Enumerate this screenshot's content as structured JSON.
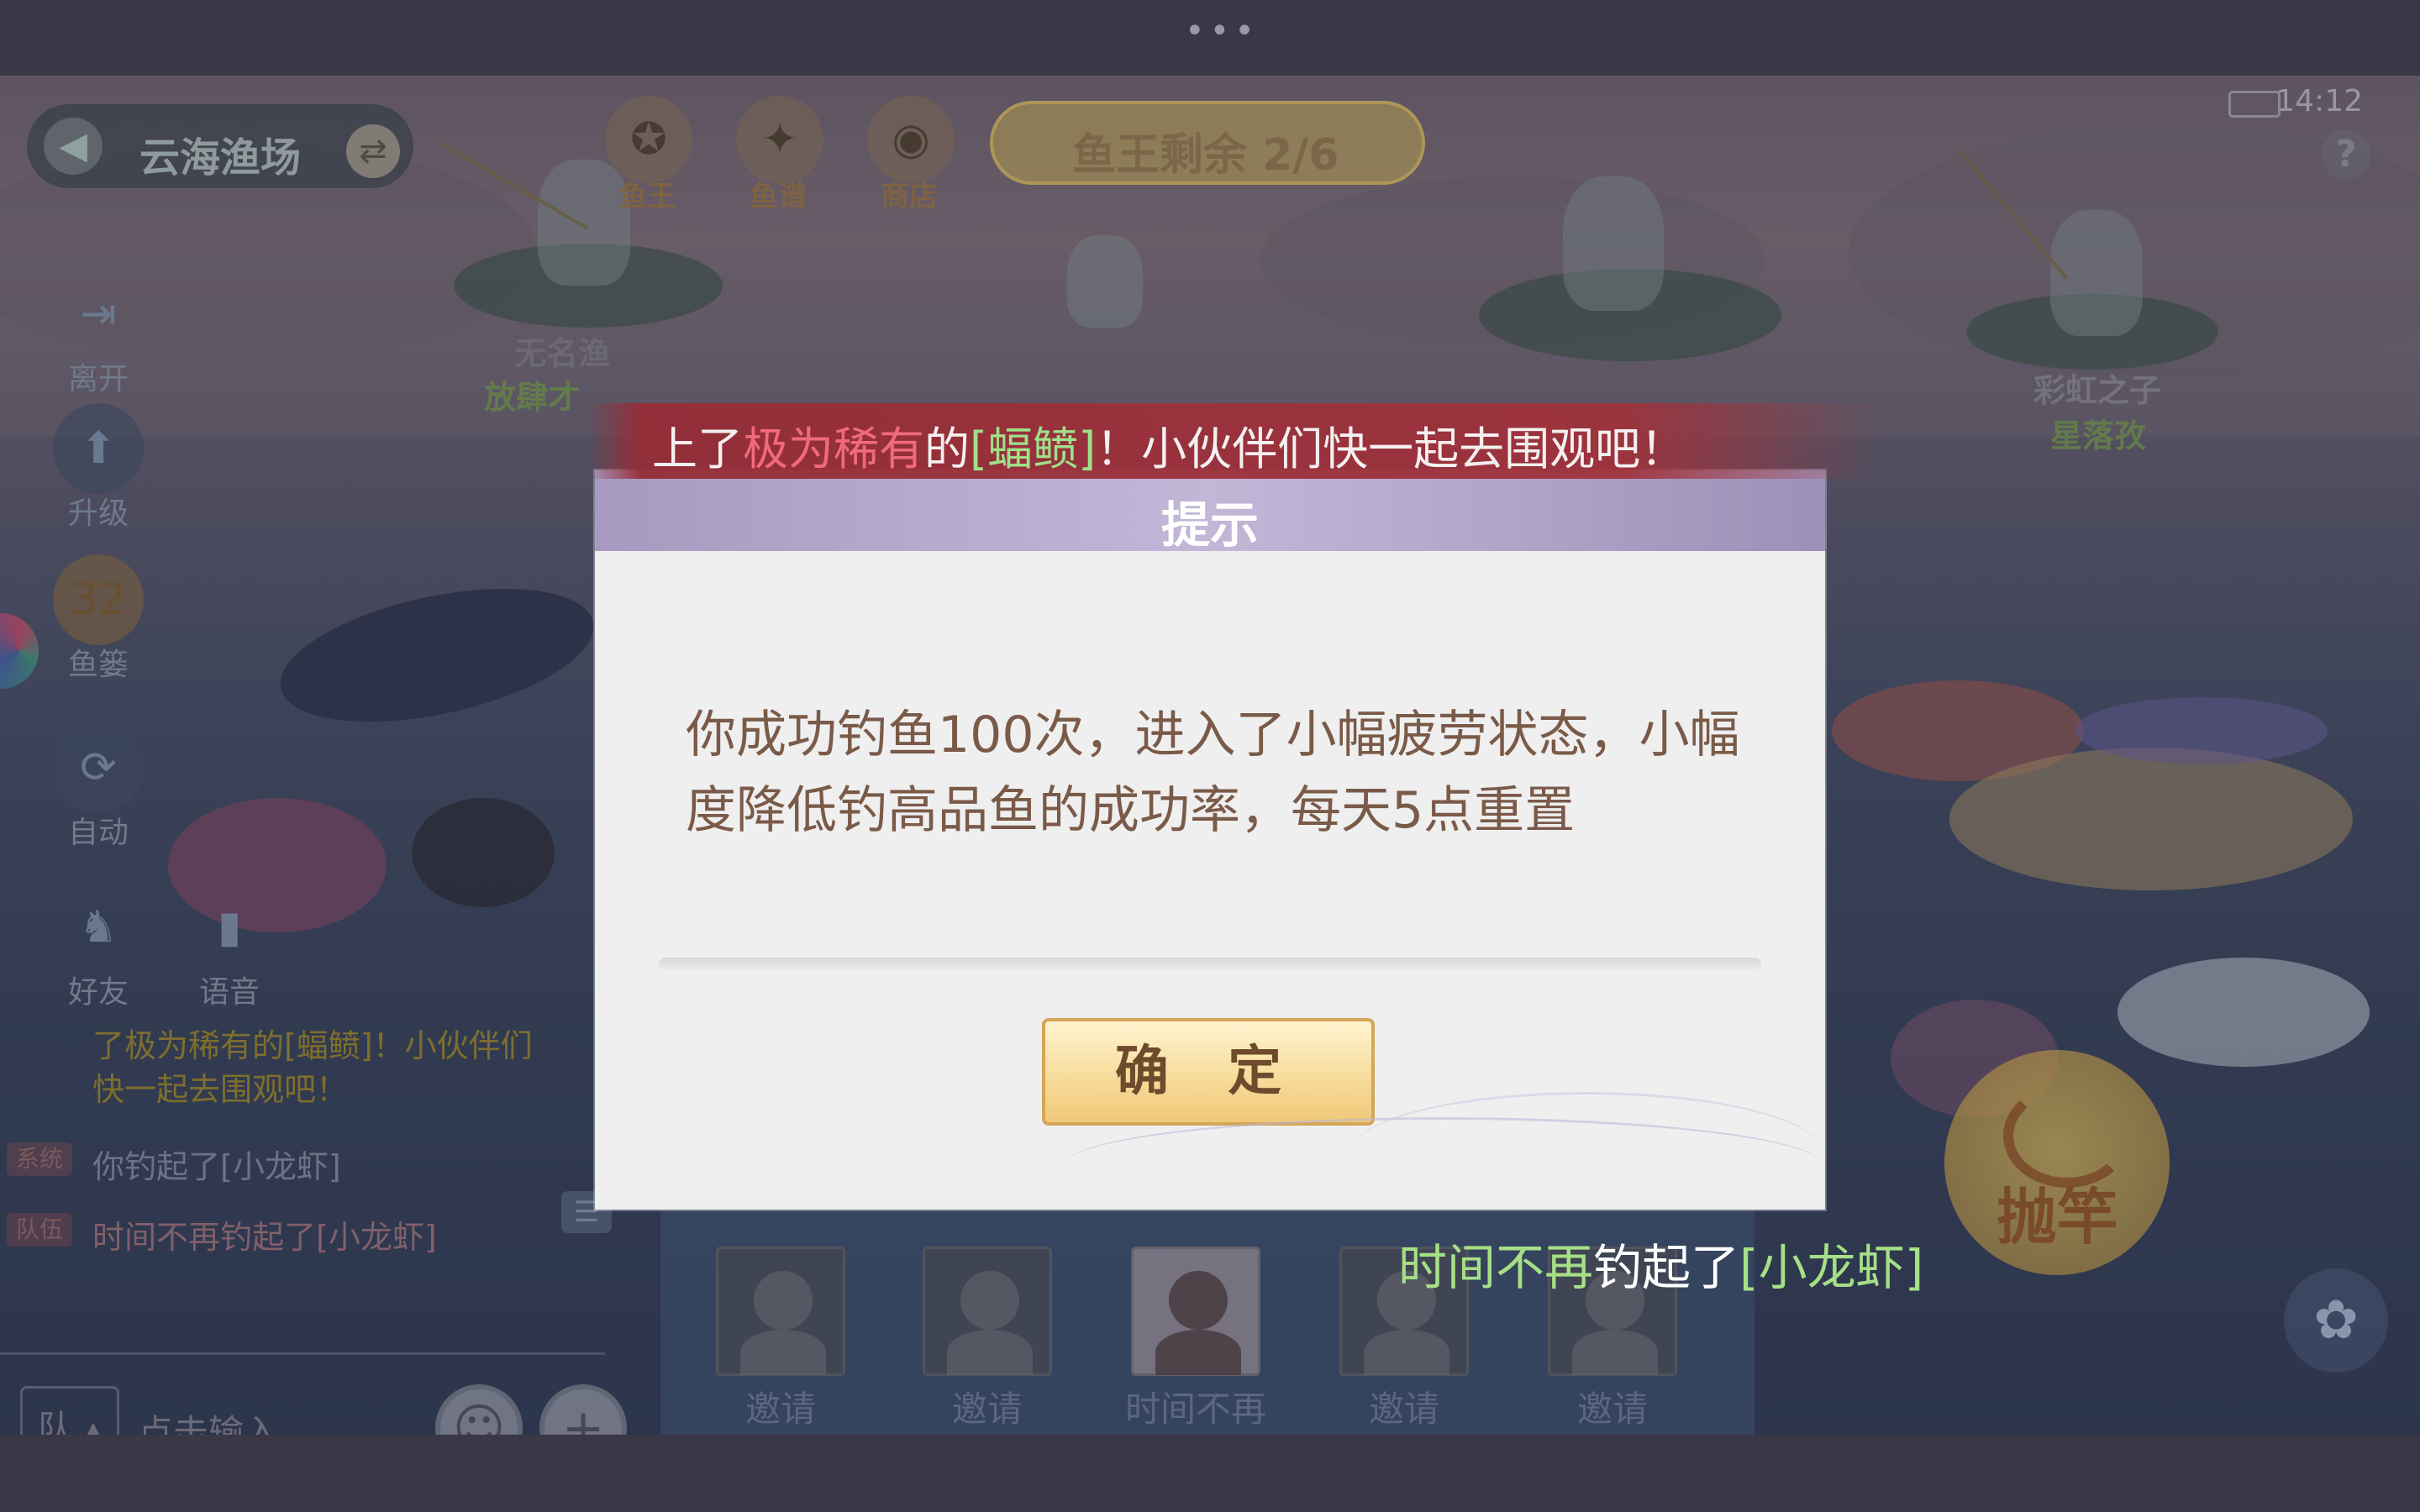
{
  "status": {
    "time": "14:12",
    "help": "?"
  },
  "location": {
    "name": "云海渔场"
  },
  "top_icons": [
    {
      "label": "鱼王",
      "icon": "fish-king-icon"
    },
    {
      "label": "鱼谱",
      "icon": "fish-book-icon"
    },
    {
      "label": "商店",
      "icon": "shop-icon"
    }
  ],
  "fish_king": {
    "text": "鱼王剩余 2/6"
  },
  "side_buttons": [
    {
      "label": "离开",
      "icon": "exit-icon",
      "glyph": "⇥"
    },
    {
      "label": "升级",
      "icon": "upgrade-icon",
      "glyph": "⬆"
    },
    {
      "label": "鱼篓",
      "icon": "fish-basket-icon",
      "glyph": "32"
    },
    {
      "label": "自动",
      "icon": "auto-icon",
      "glyph": "⟳"
    },
    {
      "label": "好友",
      "icon": "friend-icon",
      "glyph": "♞"
    },
    {
      "label": "语音",
      "icon": "voice-icon",
      "glyph": "🎤"
    }
  ],
  "fishers": {
    "left_name": "无名渔",
    "left_title": "放肆才",
    "right_name": "彩虹之子",
    "right_title": "星落孜"
  },
  "banner": {
    "part1": "上了",
    "rare": "极为稀有",
    "part2": "的",
    "fish": "[蝠鲼]",
    "part3": "！小伙伴们快一起去围观吧！"
  },
  "chat": {
    "line1a": "了极为稀有的[蝠鲼]！小伙伴们",
    "line1b": "快一起去围观吧！",
    "system_tag": "系统",
    "system_msg": "你钓起了[小龙虾]",
    "team_tag": "队伍",
    "team_msg": "时间不再钓起了[小龙虾]"
  },
  "input": {
    "channel": "队",
    "placeholder": "点击输入"
  },
  "team_slots": [
    {
      "label": "邀请",
      "filled": false
    },
    {
      "label": "邀请",
      "filled": false
    },
    {
      "label": "时间不再",
      "filled": true
    },
    {
      "label": "邀请",
      "filled": false
    },
    {
      "label": "邀请",
      "filled": false
    }
  ],
  "cast": {
    "label": "抛竿"
  },
  "catch_notice": {
    "player": "时间不再",
    "action": "钓起了",
    "item": "[小龙虾]"
  },
  "dialog": {
    "title": "提示",
    "message": "你成功钓鱼100次，进入了小幅疲劳状态，小幅度降低钓高品鱼的成功率，每天5点重置",
    "confirm": "确 定"
  },
  "colors": {
    "highlight_red": "#f06a7a",
    "highlight_green": "#9fe08a",
    "dialog_text": "#7a5a48",
    "button_gold": "#f7dc9c"
  }
}
